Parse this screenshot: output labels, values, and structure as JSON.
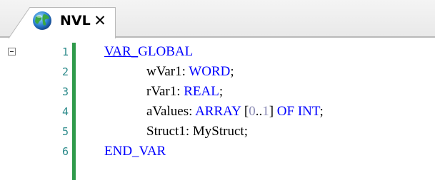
{
  "tab": {
    "label": "NVL",
    "close_glyph": "✕",
    "icon": "globe-icon"
  },
  "editor": {
    "fold_icon": "collapse-minus-icon",
    "lines": [
      {
        "number": "1",
        "tokens": [
          {
            "text": "VAR_",
            "role": "keyword-underlined"
          },
          {
            "text": "GLOBAL",
            "role": "keyword"
          }
        ]
      },
      {
        "number": "2",
        "tokens": [
          {
            "text": "wVar1: ",
            "role": "plain"
          },
          {
            "text": "WORD",
            "role": "keyword"
          },
          {
            "text": ";",
            "role": "plain"
          }
        ]
      },
      {
        "number": "3",
        "tokens": [
          {
            "text": "rVar1: ",
            "role": "plain"
          },
          {
            "text": "REAL",
            "role": "keyword"
          },
          {
            "text": ";",
            "role": "plain"
          }
        ]
      },
      {
        "number": "4",
        "tokens": [
          {
            "text": "aValues: ",
            "role": "plain"
          },
          {
            "text": "ARRAY",
            "role": "keyword"
          },
          {
            "text": " [",
            "role": "plain"
          },
          {
            "text": "0",
            "role": "number"
          },
          {
            "text": "..",
            "role": "plain"
          },
          {
            "text": "1",
            "role": "number"
          },
          {
            "text": "] ",
            "role": "plain"
          },
          {
            "text": "OF",
            "role": "keyword"
          },
          {
            "text": " ",
            "role": "plain"
          },
          {
            "text": "INT",
            "role": "keyword"
          },
          {
            "text": ";",
            "role": "plain"
          }
        ]
      },
      {
        "number": "5",
        "tokens": [
          {
            "text": "Struct1: MyStruct;",
            "role": "plain"
          }
        ]
      },
      {
        "number": "6",
        "tokens": [
          {
            "text": "END_VAR",
            "role": "keyword"
          }
        ]
      }
    ]
  },
  "colors": {
    "keyword": "#0000ff",
    "number": "#8a8ab5",
    "line_number": "#2b8a8a",
    "gutter_bar": "#2e9a4a"
  }
}
